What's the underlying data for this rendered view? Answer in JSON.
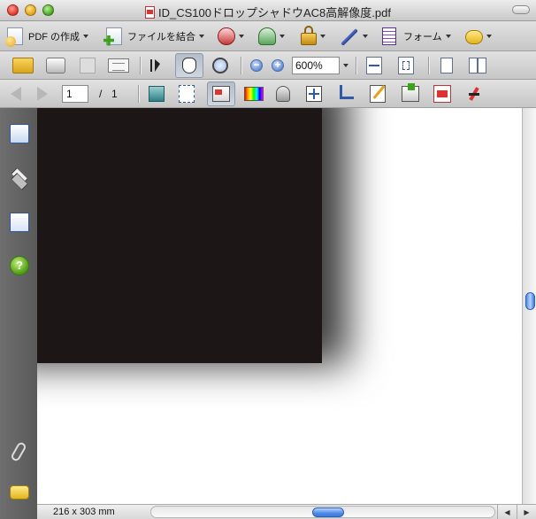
{
  "window": {
    "title": "ID_CS100ドロップシャドウAC8高解像度.pdf"
  },
  "toolbar_main": {
    "create_pdf_label": "PDF の作成",
    "combine_files_label": "ファイルを結合",
    "forms_label": "フォーム"
  },
  "toolbar_view": {
    "zoom_value": "600%"
  },
  "toolbar_nav": {
    "current_page": "1",
    "page_separator": "/",
    "total_pages": "1"
  },
  "statusbar": {
    "page_size": "216 x 303 mm"
  },
  "colors": {
    "document_background": "#ffffff",
    "black_box": "#1d1616",
    "sidebar": "#636363",
    "accent_blue": "#4d8be8"
  },
  "icons": {
    "sidebar": [
      "pages-icon",
      "layers-icon",
      "signatures-icon",
      "help-icon",
      "attachments-icon",
      "comments-icon"
    ]
  }
}
